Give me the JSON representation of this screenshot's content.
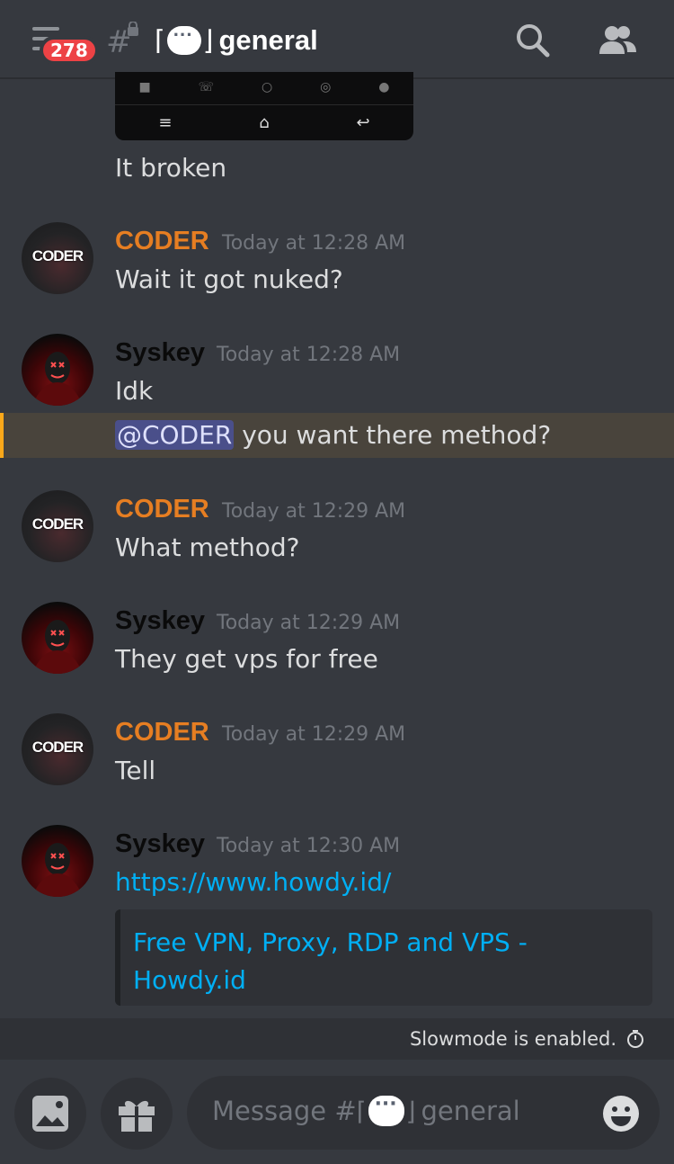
{
  "header": {
    "unread_count": "278",
    "channel_name": "general",
    "bracket_left": "⌈",
    "bracket_right": "⌋"
  },
  "prev_message": {
    "text": "It broken"
  },
  "messages": [
    {
      "author": "CODER",
      "timestamp": "Today at 12:28 AM",
      "lines": [
        "Wait it got nuked?"
      ]
    },
    {
      "author": "Syskey",
      "timestamp": "Today at 12:28 AM",
      "lines": [
        "Idk"
      ],
      "mention_line": {
        "mention": "@CODER",
        "text": " you want there method?"
      }
    },
    {
      "author": "CODER",
      "timestamp": "Today at 12:29 AM",
      "lines": [
        "What method?"
      ]
    },
    {
      "author": "Syskey",
      "timestamp": "Today at 12:29 AM",
      "lines": [
        "They get vps for free"
      ]
    },
    {
      "author": "CODER",
      "timestamp": "Today at 12:29 AM",
      "lines": [
        "Tell"
      ]
    },
    {
      "author": "Syskey",
      "timestamp": "Today at 12:30 AM",
      "link": "https://www.howdy.id/",
      "embed_title_1": "Free VPN, Proxy, RDP and VPS -",
      "embed_title_2": "Howdy.id"
    }
  ],
  "avatar_text": "CODER",
  "slowmode": "Slowmode is enabled.",
  "composer": {
    "placeholder_prefix": "Message #",
    "placeholder_channel": "general"
  },
  "colors": {
    "coder": "#e67e22",
    "link": "#00aff4",
    "mention_bg": "#4a4f8a",
    "highlight_bar": "#faa81a",
    "badge": "#ed4245"
  }
}
